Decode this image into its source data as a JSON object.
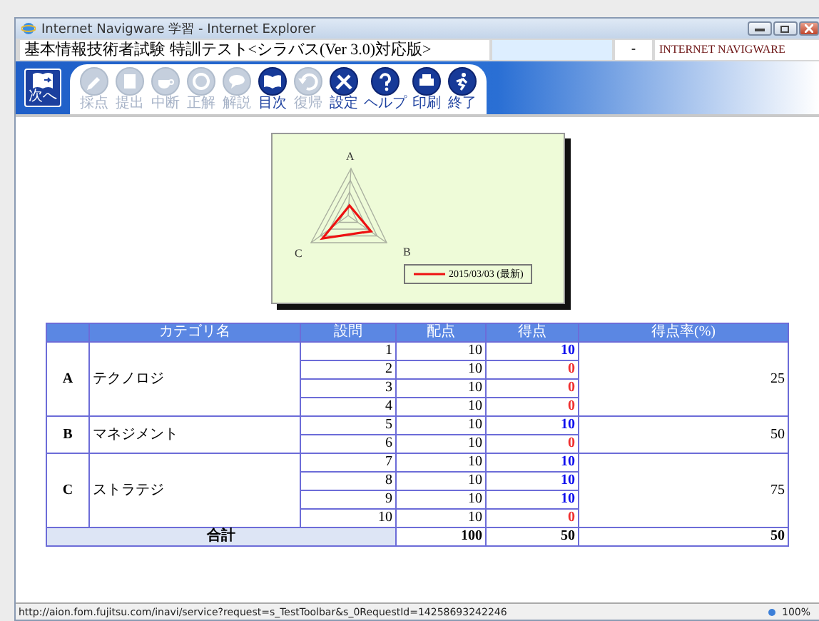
{
  "window": {
    "title": "Internet Navigware 学習 - Internet Explorer"
  },
  "header": {
    "page_title": "基本情報技術者試験 特訓テスト<シラバス(Ver 3.0)対応版>",
    "separator": "-",
    "logo": "INTERNET NAVIGWARE"
  },
  "toolbar": {
    "next_button": "次へ",
    "buttons": [
      {
        "label": "採点",
        "disabled": true
      },
      {
        "label": "提出",
        "disabled": true
      },
      {
        "label": "中断",
        "disabled": true
      },
      {
        "label": "正解",
        "disabled": true
      },
      {
        "label": "解説",
        "disabled": true
      },
      {
        "label": "目次",
        "disabled": false
      },
      {
        "label": "復帰",
        "disabled": true
      },
      {
        "label": "設定",
        "disabled": false
      },
      {
        "label": "ヘルプ",
        "disabled": false
      },
      {
        "label": "印刷",
        "disabled": false
      },
      {
        "label": "終了",
        "disabled": false
      }
    ]
  },
  "chart": {
    "axes": [
      "A",
      "B",
      "C"
    ],
    "legend": "2015/03/03 (最新)"
  },
  "table": {
    "columns": [
      "カテゴリ名",
      "設問",
      "配点",
      "得点",
      "得点率(%)"
    ],
    "groups": [
      {
        "letter": "A",
        "name": "テクノロジ",
        "rate": "25",
        "questions": [
          {
            "no": "1",
            "points": "10",
            "score": "10",
            "correct": true
          },
          {
            "no": "2",
            "points": "10",
            "score": "0",
            "correct": false
          },
          {
            "no": "3",
            "points": "10",
            "score": "0",
            "correct": false
          },
          {
            "no": "4",
            "points": "10",
            "score": "0",
            "correct": false
          }
        ]
      },
      {
        "letter": "B",
        "name": "マネジメント",
        "rate": "50",
        "questions": [
          {
            "no": "5",
            "points": "10",
            "score": "10",
            "correct": true
          },
          {
            "no": "6",
            "points": "10",
            "score": "0",
            "correct": false
          }
        ]
      },
      {
        "letter": "C",
        "name": "ストラテジ",
        "rate": "75",
        "questions": [
          {
            "no": "7",
            "points": "10",
            "score": "10",
            "correct": true
          },
          {
            "no": "8",
            "points": "10",
            "score": "10",
            "correct": true
          },
          {
            "no": "9",
            "points": "10",
            "score": "10",
            "correct": true
          },
          {
            "no": "10",
            "points": "10",
            "score": "0",
            "correct": false
          }
        ]
      }
    ],
    "total": {
      "label": "合計",
      "points": "100",
      "score": "50",
      "rate": "50"
    }
  },
  "status_bar": {
    "url": "http://aion.fom.fujitsu.com/inavi/service?request=s_TestToolbar&s_0RequestId=14258693242246",
    "zoom": "100%"
  }
}
